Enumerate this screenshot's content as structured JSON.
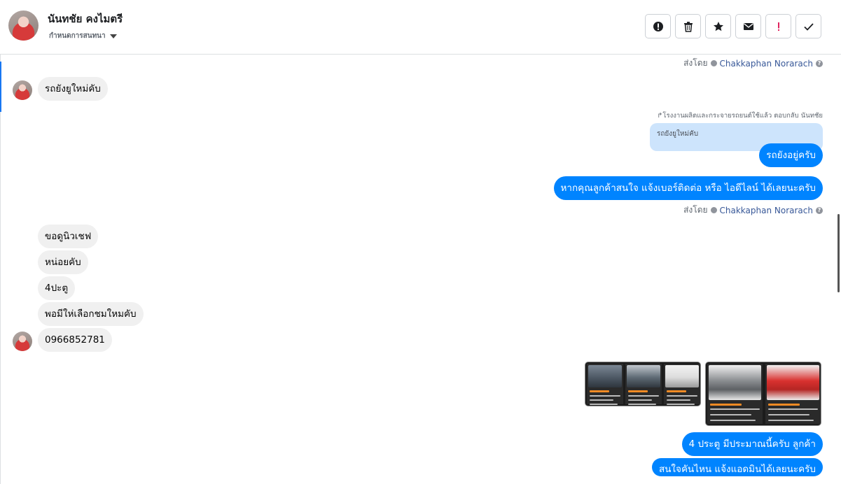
{
  "header": {
    "contact_name": "นันทชัย คงไมตรี",
    "assign_label": "กำหนดการสนทนา",
    "actions": [
      {
        "name": "spam-icon",
        "label": "spam"
      },
      {
        "name": "trash-icon",
        "label": "delete"
      },
      {
        "name": "star-icon",
        "label": "star"
      },
      {
        "name": "mail-icon",
        "label": "mark unread"
      },
      {
        "name": "exclamation-icon",
        "label": "important"
      },
      {
        "name": "check-icon",
        "label": "done"
      }
    ]
  },
  "messages": {
    "sent_by_prefix": "ส่งโดย",
    "sent_by_name": "Chakkaphan Norarach",
    "help_glyph": "?",
    "m1": "รถยังยูใหม่คับ",
    "reply_label": "↱โรงงานผลิตและกระจายรถยนต์ใช้แล้ว ตอบกลับ นันทชัย",
    "reply_quote": "รถยังยูใหม่คับ",
    "m2": "รถยังอยู่ครับ",
    "m3": "หากคุณลูกค้าสนใจ แจ้งเบอร์ติดต่อ หรือ ไอดีไลน์ ได้เลยนะครับ",
    "m4": "ขอดูนิวเชฟ",
    "m5": "หน่อยคับ",
    "m6": "4ปะตู",
    "m7": "พอมีให่เลือกชมใหมคับ",
    "m8": "0966852781",
    "m9": "4 ประตู มีประมาณนี้ครับ ลูกค้า",
    "m10": "สนใจคันไหน แจ้งแอดมินได้เลยนะครับ"
  },
  "colors": {
    "outgoing": "#0084ff",
    "incoming": "#f0f0f0",
    "reply_quote": "#cde4fc",
    "link": "#385898",
    "accent": "#1877f2"
  }
}
